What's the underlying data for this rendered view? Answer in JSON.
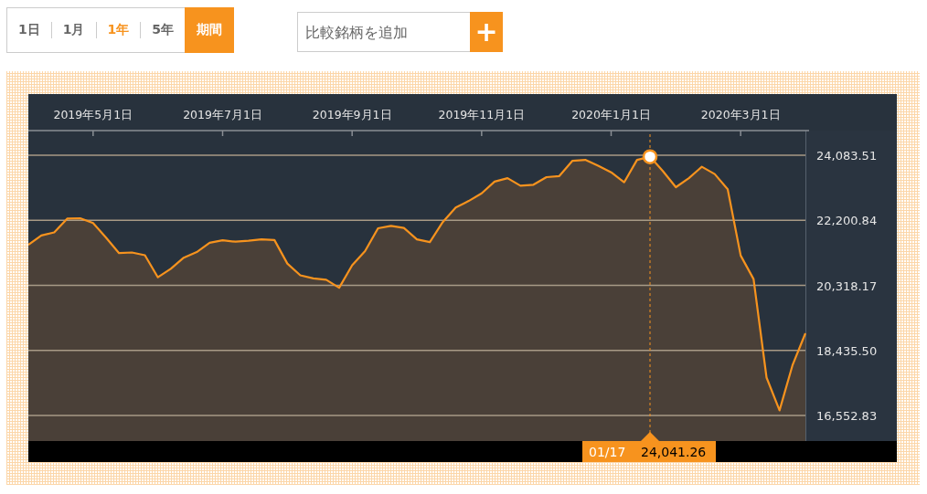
{
  "range_tabs": [
    {
      "label": "1日",
      "selected": false
    },
    {
      "label": "1月",
      "selected": false
    },
    {
      "label": "1年",
      "selected": true
    },
    {
      "label": "5年",
      "selected": false
    }
  ],
  "period_button": "期間",
  "compare_field": {
    "placeholder": "比較銘柄を追加",
    "button": "+"
  },
  "chart": {
    "chart_data": {
      "type": "area",
      "categories": [
        null,
        null,
        null,
        null,
        null,
        "2019年5月1日",
        null,
        null,
        null,
        null,
        null,
        null,
        null,
        null,
        null,
        "2019年7月1日",
        null,
        null,
        null,
        null,
        null,
        null,
        null,
        null,
        null,
        "2019年9月1日",
        null,
        null,
        null,
        null,
        null,
        null,
        null,
        null,
        null,
        "2019年11月1日",
        null,
        null,
        null,
        null,
        null,
        null,
        null,
        null,
        null,
        "2020年1月1日",
        null,
        null,
        null,
        null,
        null,
        null,
        null,
        null,
        null,
        "2020年3月1日",
        null,
        null,
        null,
        null,
        null
      ],
      "series": [
        {
          "color": "#f7931e",
          "values": [
            21490,
            21760,
            21850,
            22250,
            22260,
            22120,
            21700,
            21250,
            21270,
            21190,
            20550,
            20800,
            21120,
            21280,
            21550,
            21620,
            21580,
            21610,
            21650,
            21630,
            20950,
            20610,
            20520,
            20480,
            20250,
            20900,
            21310,
            21970,
            22040,
            21980,
            21650,
            21570,
            22150,
            22570,
            22760,
            22980,
            23320,
            23420,
            23200,
            23230,
            23450,
            23480,
            23920,
            23950,
            23780,
            23590,
            23300,
            23950,
            24040,
            23620,
            23160,
            23420,
            23750,
            23540,
            23100,
            21180,
            20500,
            17650,
            16700,
            18000,
            18930
          ]
        }
      ],
      "grid": true,
      "ylim": [
        15813,
        24797
      ],
      "yticks": [
        {
          "value": 24083.51,
          "label": "24,083.51"
        },
        {
          "value": 22200.84,
          "label": "22,200.84"
        },
        {
          "value": 20318.17,
          "label": "20,318.17"
        },
        {
          "value": 18435.5,
          "label": "18,435.50"
        },
        {
          "value": 16552.83,
          "label": "16,552.83"
        }
      ]
    },
    "cursor": {
      "date": "01/17",
      "reading": "24,041.26"
    }
  }
}
